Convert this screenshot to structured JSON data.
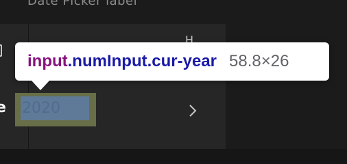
{
  "field": {
    "label": "Date Picker label"
  },
  "calendar": {
    "month_partial": "e",
    "year_value": "2020",
    "top_right_glyph": "Ḥ",
    "icons": {
      "left_edge": "calendar-icon",
      "next": "chevron-right-icon"
    }
  },
  "inspector": {
    "tag": "input",
    "classes": ".numInput.cur-year",
    "width": "58.8",
    "times": "×",
    "height": "26",
    "colors": {
      "tag": "#881280",
      "classes": "#1a1aa6",
      "dims": "#5f6368",
      "highlight_padding": "#676e48",
      "highlight_content": "#5f7a98"
    }
  }
}
